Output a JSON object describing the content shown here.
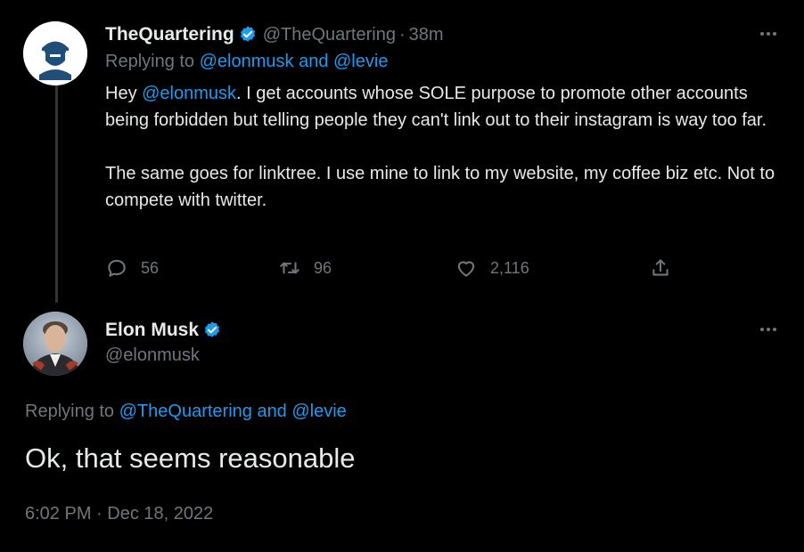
{
  "parent_tweet": {
    "author_name": "TheQuartering",
    "author_handle": "@TheQuartering",
    "separator": "·",
    "time_ago": "38m",
    "replying_prefix": "Replying to ",
    "replying_to": "@elonmusk and @levie",
    "text_prefix": "Hey ",
    "text_mention": "@elonmusk",
    "text_rest": ". I get accounts whose SOLE purpose to promote other accounts being forbidden but telling people they can't link out to their instagram is way too far.",
    "text_paragraph2": "The same goes for linktree.  I use mine to link to my website, my coffee biz etc.  Not to compete with twitter.",
    "replies": "56",
    "retweets": "96",
    "likes": "2,116",
    "icons": [
      "reply-icon",
      "retweet-icon",
      "like-icon",
      "share-icon",
      "more-options-icon",
      "verified-badge-icon"
    ]
  },
  "main_tweet": {
    "author_name": "Elon Musk",
    "author_handle": "@elonmusk",
    "replying_prefix": "Replying to ",
    "replying_to": "@TheQuartering and @levie",
    "text": "Ok, that seems reasonable",
    "timestamp": "6:02 PM · Dec 18, 2022"
  },
  "colors": {
    "background": "#000000",
    "text_primary": "#e7e9ea",
    "text_secondary": "#71767b",
    "accent": "#1d9bf0",
    "thread_line": "#333639"
  }
}
